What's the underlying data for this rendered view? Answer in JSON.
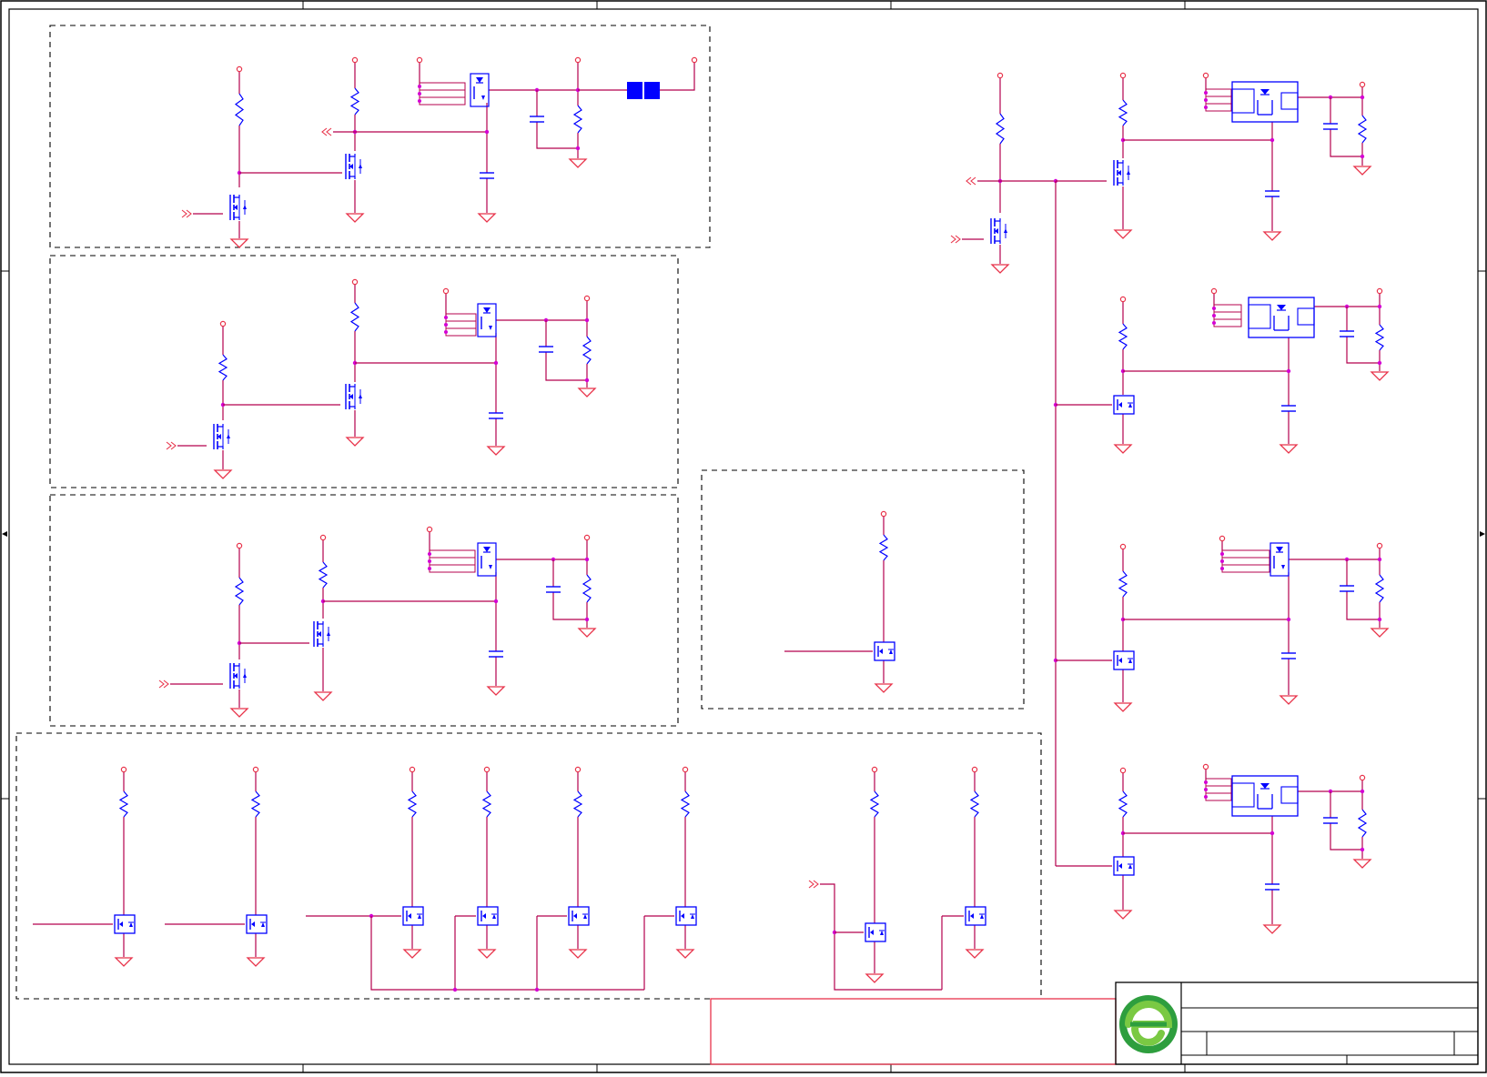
{
  "sheet": {
    "title": "",
    "border_color": "#000000",
    "wire_color": "#b4004e",
    "net_color": "#e8334a",
    "part_color": "#0000ff",
    "junction_color": "#d400d4",
    "frame_box_color": "#e8334a"
  },
  "title_block": {
    "logo": "logo-icon",
    "logo_colors": [
      "#2e9e3e",
      "#7ac943"
    ]
  },
  "groups": [
    {
      "name": "group-top-left"
    },
    {
      "name": "group-mid-left"
    },
    {
      "name": "group-lower-left"
    },
    {
      "name": "group-center"
    },
    {
      "name": "group-bottom"
    },
    {
      "name": "group-right-column"
    }
  ]
}
